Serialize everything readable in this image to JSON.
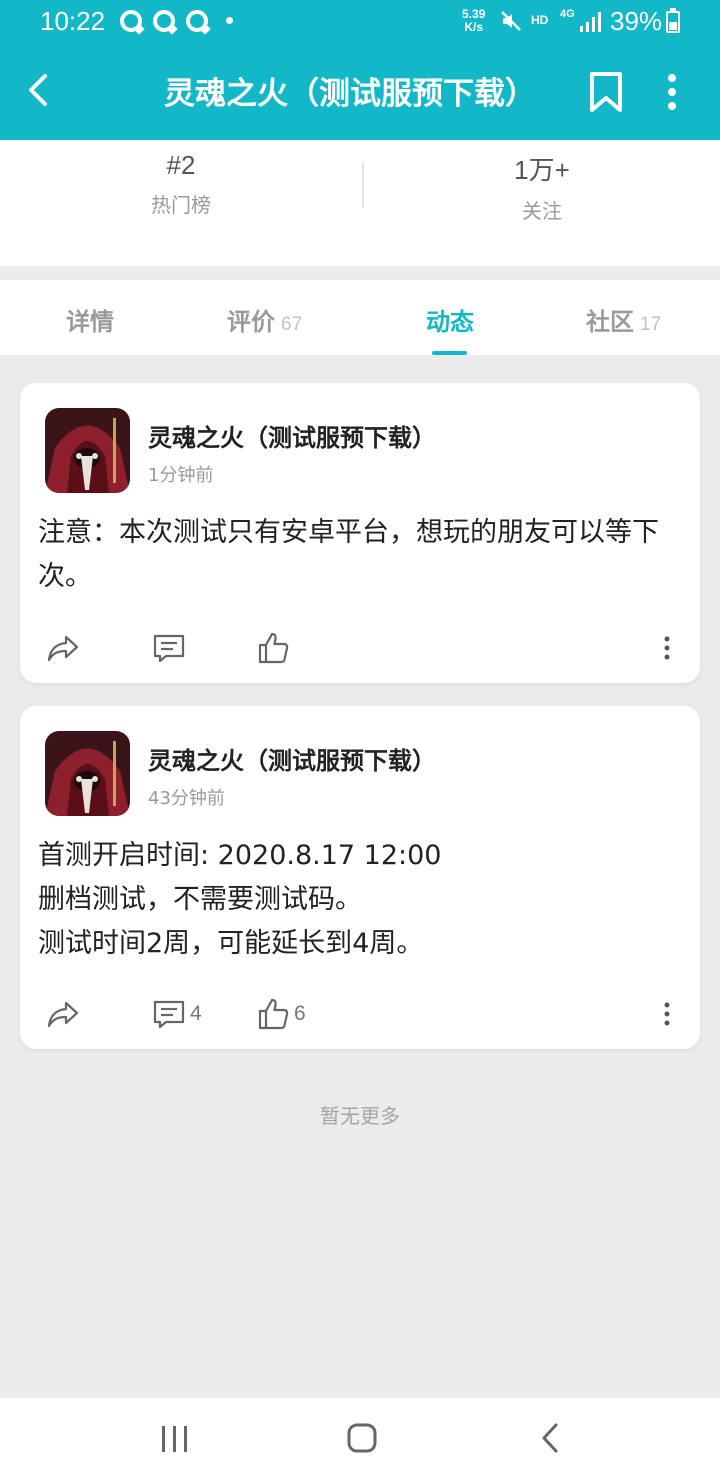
{
  "status_bar": {
    "time": "10:22",
    "net_speed_value": "5.39",
    "net_speed_unit": "K/s",
    "hd": "HD",
    "network": "4G",
    "battery": "39%"
  },
  "header": {
    "title": "灵魂之火（测试服预下载）"
  },
  "stats": {
    "rank_value": "#2",
    "rank_label": "热门榜",
    "follow_value": "1万+",
    "follow_label": "关注"
  },
  "tabs": [
    {
      "label": "详情",
      "count": ""
    },
    {
      "label": "评价",
      "count": "67"
    },
    {
      "label": "动态",
      "count": ""
    },
    {
      "label": "社区",
      "count": "17"
    }
  ],
  "active_tab": "动态",
  "posts": [
    {
      "author": "灵魂之火（测试服预下载）",
      "time": "1分钟前",
      "body": "注意：本次测试只有安卓平台，想玩的朋友可以等下次。",
      "comments": "",
      "likes": ""
    },
    {
      "author": "灵魂之火（测试服预下载）",
      "time": "43分钟前",
      "body": "首测开启时间: 2020.8.17 12:00\n删档测试，不需要测试码。\n测试时间2周，可能延长到4周。",
      "comments": "4",
      "likes": "6"
    }
  ],
  "footer_text": "暂无更多",
  "colors": {
    "accent": "#13b8c8",
    "background": "#ebebeb"
  },
  "icons": {
    "back": "chevron-left-icon",
    "bookmark": "bookmark-icon",
    "more": "more-vertical-icon",
    "share": "share-icon",
    "comment": "comment-icon",
    "like": "thumbs-up-icon"
  }
}
